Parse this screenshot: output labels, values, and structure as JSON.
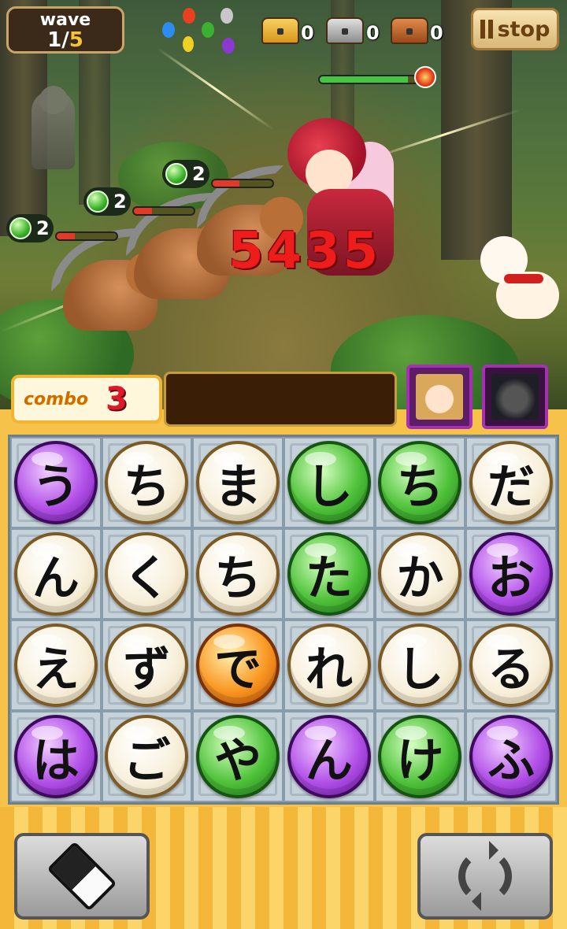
{
  "hud": {
    "wave_label": "wave",
    "wave_current": "1",
    "wave_separator": "/",
    "wave_total": "5",
    "stop_label": "stop",
    "chests": [
      {
        "name": "gold-chest-icon",
        "color": "#e8b02a",
        "count": "0"
      },
      {
        "name": "silver-chest-icon",
        "color": "#a9a9a9",
        "count": "0"
      },
      {
        "name": "bronze-chest-icon",
        "color": "#c0652a",
        "count": "0"
      }
    ],
    "element_icons": [
      "fire-element-icon",
      "water-element-icon",
      "thunder-element-icon",
      "wood-element-icon",
      "light-element-icon",
      "dark-element-icon"
    ]
  },
  "battle": {
    "damage": "5435",
    "enemies": [
      {
        "name": "enemy-wolf-1",
        "turns": "2",
        "hp": 0.3
      },
      {
        "name": "enemy-wolf-2",
        "turns": "2",
        "hp": 0.3
      },
      {
        "name": "enemy-wolf-3",
        "turns": "2",
        "hp": 0.45
      }
    ],
    "hero_hp": 0.9
  },
  "combo": {
    "label": "combo",
    "count": "3"
  },
  "board": {
    "rows": [
      [
        {
          "ch": "う",
          "type": "purple"
        },
        {
          "ch": "ち",
          "type": "plain"
        },
        {
          "ch": "ま",
          "type": "plain"
        },
        {
          "ch": "し",
          "type": "green"
        },
        {
          "ch": "ち",
          "type": "green"
        },
        {
          "ch": "だ",
          "type": "plain"
        }
      ],
      [
        {
          "ch": "ん",
          "type": "plain"
        },
        {
          "ch": "く",
          "type": "plain"
        },
        {
          "ch": "ち",
          "type": "plain"
        },
        {
          "ch": "た",
          "type": "green"
        },
        {
          "ch": "か",
          "type": "plain"
        },
        {
          "ch": "お",
          "type": "purple"
        }
      ],
      [
        {
          "ch": "え",
          "type": "plain"
        },
        {
          "ch": "ず",
          "type": "plain"
        },
        {
          "ch": "で",
          "type": "orange"
        },
        {
          "ch": "れ",
          "type": "plain"
        },
        {
          "ch": "し",
          "type": "plain"
        },
        {
          "ch": "る",
          "type": "plain"
        }
      ],
      [
        {
          "ch": "は",
          "type": "purple"
        },
        {
          "ch": "ご",
          "type": "plain"
        },
        {
          "ch": "や",
          "type": "green"
        },
        {
          "ch": "ん",
          "type": "purple"
        },
        {
          "ch": "け",
          "type": "green"
        },
        {
          "ch": "ふ",
          "type": "purple"
        }
      ]
    ]
  },
  "bottom": {
    "left_icon": "eraser-icon",
    "right_icon": "refresh-icon"
  }
}
